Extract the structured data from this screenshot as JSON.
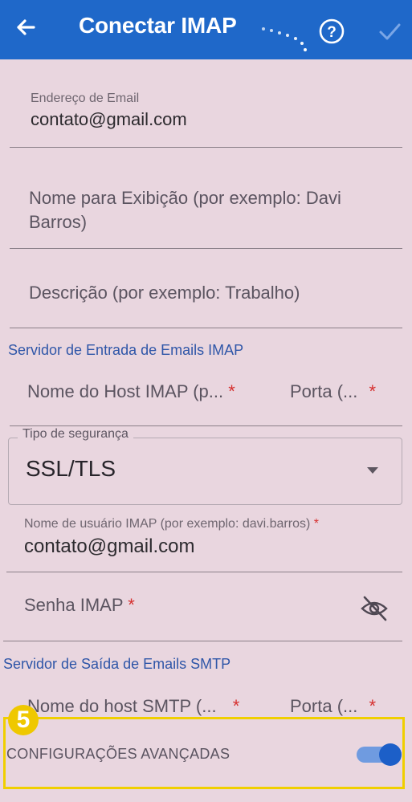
{
  "appbar": {
    "title": "Conectar IMAP",
    "back_icon": "arrow-left-icon",
    "help_icon": "help-circle-icon",
    "confirm_icon": "check-icon",
    "color": "#1f68c9"
  },
  "email": {
    "label": "Endereço de Email",
    "value": "contato@gmail.com"
  },
  "display_name": {
    "placeholder": "Nome para Exibição (por exemplo: Davi Barros)"
  },
  "description": {
    "placeholder": "Descrição (por exemplo: Trabalho)"
  },
  "incoming": {
    "section_title": "Servidor de Entrada de Emails IMAP",
    "host_placeholder": "Nome do Host IMAP (p...",
    "port_placeholder": "Porta (...",
    "required_mark": "*",
    "security_label": "Tipo de segurança",
    "security_value": "SSL/TLS",
    "username_label": "Nome de usuário IMAP (por exemplo: davi.barros)",
    "username_value": "contato@gmail.com",
    "password_placeholder": "Senha IMAP"
  },
  "outgoing": {
    "section_title": "Servidor de Saída de Emails SMTP",
    "host_placeholder": "Nome do host SMTP (...",
    "port_placeholder": "Porta (..."
  },
  "advanced": {
    "label": "CONFIGURAÇÕES AVANÇADAS",
    "step_badge": "5",
    "toggle_on": true,
    "highlight_color": "#f0cf00"
  }
}
